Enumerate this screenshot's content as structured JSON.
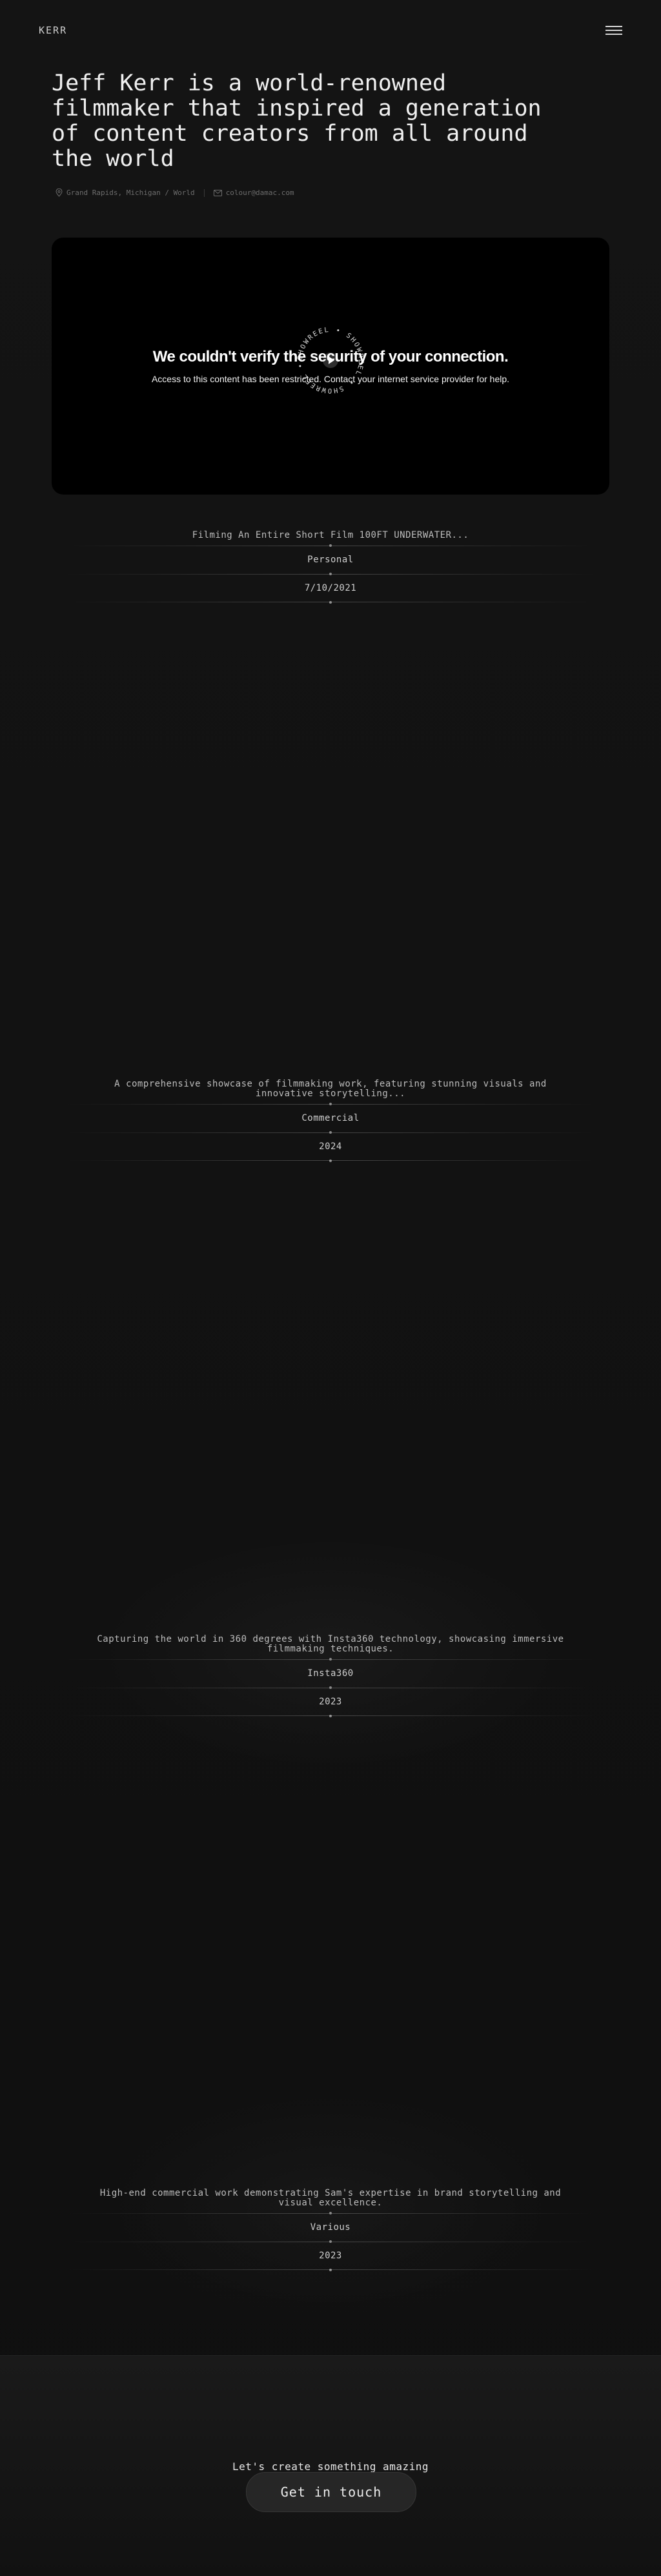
{
  "header": {
    "logo": "KERR",
    "menu_icon": "hamburger-menu-icon"
  },
  "hero": {
    "title": "Jeff Kerr is a world-renowned filmmaker that inspired a generation of content creators from all around the world",
    "location": "Grand Rapids, Michigan / World",
    "email": "colour@damac.com"
  },
  "video": {
    "error_title": "We couldn't verify the security of your connection.",
    "error_text": "Access to this content has been restricted. Contact your internet service provider for help.",
    "badge_text": "SHOWREEL • SHOWREEL • SHOWREEL • "
  },
  "projects": [
    {
      "description": "Filming An Entire Short Film 100FT UNDERWATER...",
      "category": "Personal",
      "date": "7/10/2021"
    },
    {
      "description": "A comprehensive showcase of filmmaking work, featuring stunning visuals and innovative storytelling...",
      "category": "Commercial",
      "date": "2024"
    },
    {
      "description": "Capturing the world in 360 degrees with Insta360 technology, showcasing immersive filmmaking techniques.",
      "category": "Insta360",
      "date": "2023"
    },
    {
      "description": "High-end commercial work demonstrating Sam's expertise in brand storytelling and visual excellence.",
      "category": "Various",
      "date": "2023"
    }
  ],
  "footer": {
    "cta_text": "Let's create something amazing",
    "button_label": "Get in touch"
  }
}
